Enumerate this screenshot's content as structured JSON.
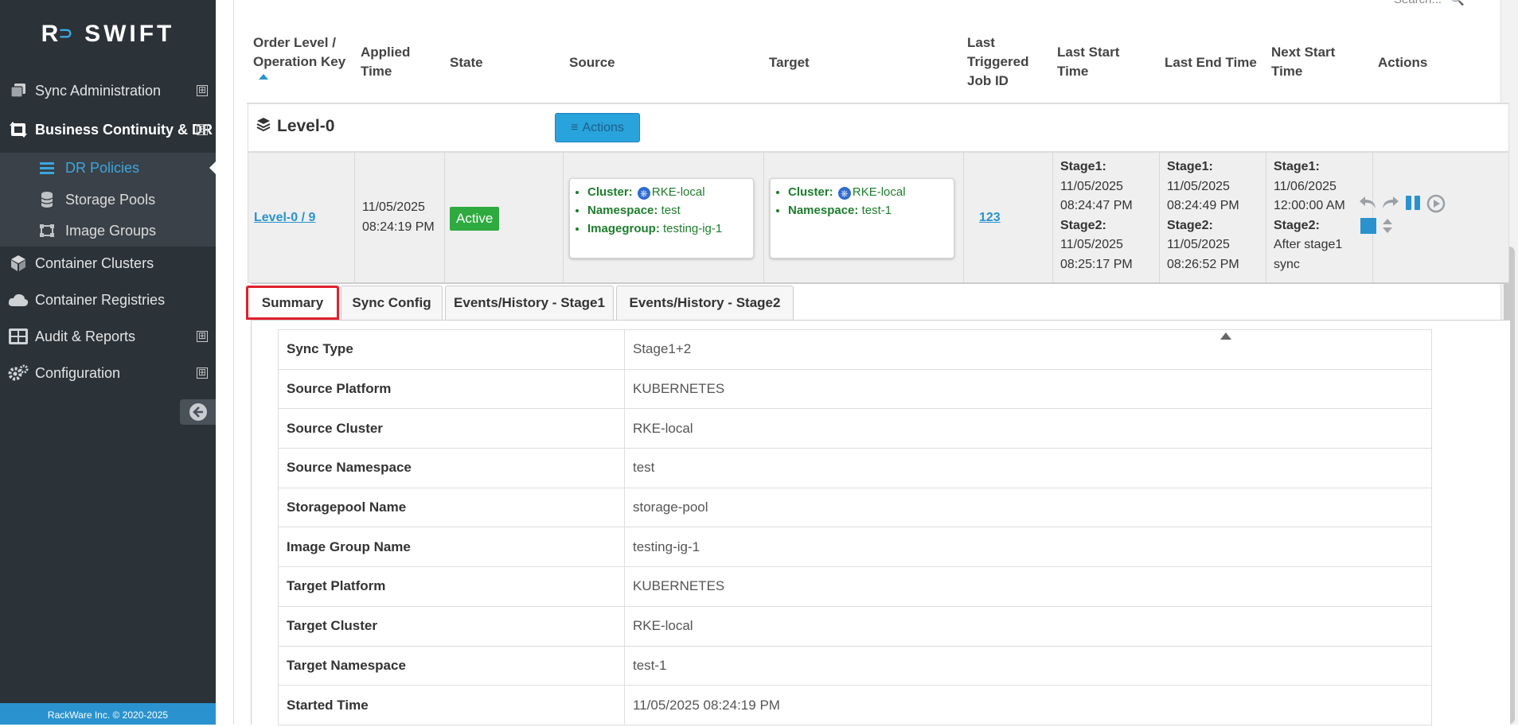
{
  "app": {
    "brand": "SWIFT",
    "footer": "RackWare Inc. © 2020-2025"
  },
  "sidebar": {
    "items": [
      {
        "label": "Sync Administration",
        "icon": "copy-icon",
        "expandable": true,
        "expanded": false
      },
      {
        "label": "Business Continuity & DR",
        "icon": "dr-icon",
        "expandable": true,
        "expanded": true
      },
      {
        "label": "Container Clusters",
        "icon": "cube-icon"
      },
      {
        "label": "Container Registries",
        "icon": "cloud-icon"
      },
      {
        "label": "Audit & Reports",
        "icon": "table-icon",
        "expandable": true,
        "expanded": false
      },
      {
        "label": "Configuration",
        "icon": "gears-icon",
        "expandable": true,
        "expanded": false
      }
    ],
    "subitems": [
      {
        "label": "DR Policies",
        "icon": "list-icon",
        "current": true
      },
      {
        "label": "Storage Pools",
        "icon": "database-icon"
      },
      {
        "label": "Image Groups",
        "icon": "image-group-icon"
      }
    ],
    "toggle_expand": "⊞",
    "toggle_collapse": "⊟"
  },
  "search": {
    "placeholder": "Search..."
  },
  "table": {
    "headers": [
      [
        "Order Level /",
        "Operation Key"
      ],
      [
        "Applied",
        "Time"
      ],
      [
        "State"
      ],
      [
        "Source"
      ],
      [
        "Target"
      ],
      [
        "Last",
        "Triggered",
        "Job ID"
      ],
      [
        "Last Start",
        "Time"
      ],
      [
        "Last End Time"
      ],
      [
        "Next Start",
        "Time"
      ],
      [
        "Actions"
      ]
    ],
    "level": {
      "title": "Level-0",
      "actions_label": "Actions"
    },
    "row": {
      "key": "Level-0 / 9",
      "applied": [
        "11/05/2025",
        "08:24:19 PM"
      ],
      "state": "Active",
      "source": {
        "cluster_label": "Cluster:",
        "cluster": "RKE-local",
        "namespace_label": "Namespace:",
        "namespace": "test",
        "imagegroup_label": "Imagegroup:",
        "imagegroup": "testing-ig-1"
      },
      "target": {
        "cluster_label": "Cluster:",
        "cluster": "RKE-local",
        "namespace_label": "Namespace:",
        "namespace": "test-1"
      },
      "job_id": "123",
      "last_start": {
        "s1_label": "Stage1:",
        "s1": [
          "11/05/2025",
          "08:24:47 PM"
        ],
        "s2_label": "Stage2:",
        "s2": [
          "11/05/2025",
          "08:25:17 PM"
        ]
      },
      "last_end": {
        "s1_label": "Stage1:",
        "s1": [
          "11/05/2025",
          "08:24:49 PM"
        ],
        "s2_label": "Stage2:",
        "s2": [
          "11/05/2025",
          "08:26:52 PM"
        ]
      },
      "next_start": {
        "s1_label": "Stage1:",
        "s1": [
          "11/06/2025",
          "12:00:00 AM"
        ],
        "s2_label": "Stage2:",
        "s2": [
          "After stage1",
          "sync"
        ]
      }
    }
  },
  "tabs": [
    {
      "label": "Summary",
      "selected": true
    },
    {
      "label": "Sync Config"
    },
    {
      "label": "Events/History - Stage1"
    },
    {
      "label": "Events/History - Stage2"
    }
  ],
  "summary": [
    {
      "key": "Sync Type",
      "value": "Stage1+2"
    },
    {
      "key": "Source Platform",
      "value": "KUBERNETES"
    },
    {
      "key": "Source Cluster",
      "value": "RKE-local"
    },
    {
      "key": "Source Namespace",
      "value": "test"
    },
    {
      "key": "Storagepool Name",
      "value": "storage-pool"
    },
    {
      "key": "Image Group Name",
      "value": "testing-ig-1"
    },
    {
      "key": "Target Platform",
      "value": "KUBERNETES"
    },
    {
      "key": "Target Cluster",
      "value": "RKE-local"
    },
    {
      "key": "Target Namespace",
      "value": "test-1"
    },
    {
      "key": "Started Time",
      "value": "11/05/2025 08:24:19 PM"
    }
  ],
  "colors": {
    "sidebar": "#2b3238",
    "accent": "#2a93cf",
    "active": "#2eaa3f",
    "highlight": "#e0202c"
  }
}
